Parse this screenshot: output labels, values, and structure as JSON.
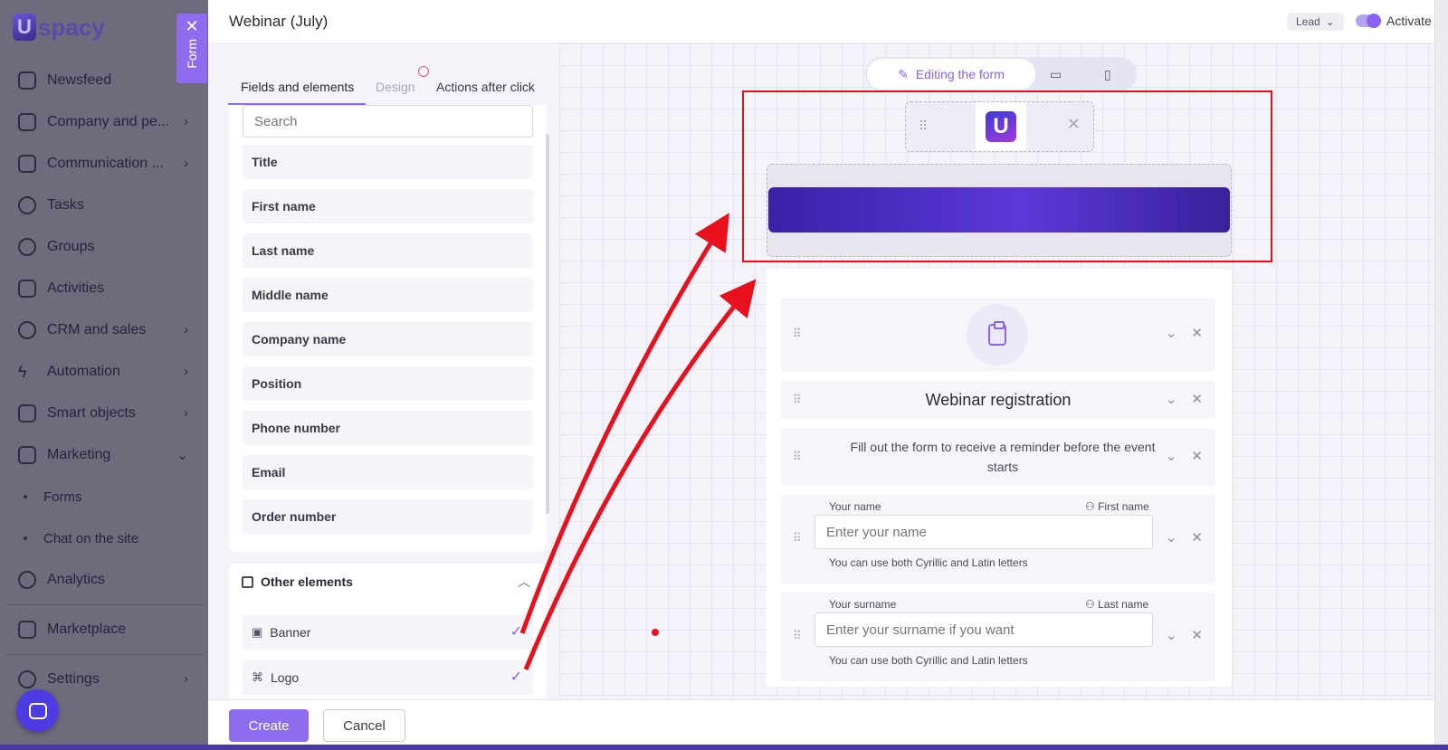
{
  "brand": {
    "mark": "U",
    "name": "spacy"
  },
  "sidebar": {
    "items": [
      {
        "label": "Newsfeed",
        "icon": "home-icon",
        "chevron": false
      },
      {
        "label": "Company and pe...",
        "icon": "building-icon",
        "chevron": true
      },
      {
        "label": "Communication ...",
        "icon": "chat-icon",
        "chevron": true
      },
      {
        "label": "Tasks",
        "icon": "check-circle-icon",
        "chevron": false
      },
      {
        "label": "Groups",
        "icon": "users-icon",
        "chevron": false
      },
      {
        "label": "Activities",
        "icon": "calendar-icon",
        "chevron": false
      },
      {
        "label": "CRM and sales",
        "icon": "database-icon",
        "chevron": true
      },
      {
        "label": "Automation",
        "icon": "lightning-icon",
        "chevron": true
      },
      {
        "label": "Smart objects",
        "icon": "scan-icon",
        "chevron": true
      },
      {
        "label": "Marketing",
        "icon": "megaphone-icon",
        "chevron": true,
        "expanded": true
      }
    ],
    "marketing_sub": [
      "Forms",
      "Chat on the site"
    ],
    "analytics": "Analytics",
    "marketplace": "Marketplace",
    "settings": "Settings"
  },
  "form_tab": {
    "label": "Form",
    "close": "✕"
  },
  "header": {
    "title": "Webinar (July)",
    "entity_select": "Lead",
    "activate_label": "Activate"
  },
  "tabs": [
    "Fields and elements",
    "Design",
    "Actions after click"
  ],
  "fields_panel": {
    "search_placeholder": "Search",
    "fields": [
      "Title",
      "First name",
      "Last name",
      "Middle name",
      "Company name",
      "Position",
      "Phone number",
      "Email",
      "Order number"
    ]
  },
  "other_elements": {
    "title": "Other elements",
    "items": [
      {
        "label": "Banner",
        "icon": "image-icon",
        "checked": true
      },
      {
        "label": "Logo",
        "icon": "command-icon",
        "checked": true
      }
    ]
  },
  "mode_bar": {
    "active_label": "Editing the form"
  },
  "form": {
    "title": "Webinar registration",
    "description": "Fill out the form to receive a reminder before the event starts",
    "fields": [
      {
        "label": "Your name",
        "mapping": "First name",
        "placeholder": "Enter your name",
        "hint": "You can use both Cyrillic and Latin letters"
      },
      {
        "label": "Your surname",
        "mapping": "Last name",
        "placeholder": "Enter your surname if you want",
        "hint": "You can use both Cyrillic and Latin letters"
      }
    ]
  },
  "footer": {
    "create": "Create",
    "cancel": "Cancel"
  },
  "colors": {
    "accent": "#8d6cf0",
    "annotation": "#e8101c",
    "banner": "#4a2cc0"
  }
}
